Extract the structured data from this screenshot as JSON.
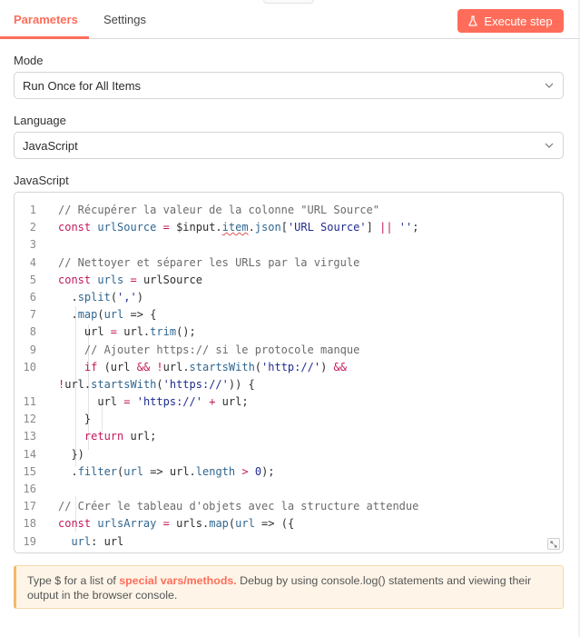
{
  "tabs": [
    {
      "label": "Parameters",
      "active": true
    },
    {
      "label": "Settings",
      "active": false
    }
  ],
  "execute_button": {
    "label": "Execute step",
    "icon": "flask-icon"
  },
  "mode": {
    "label": "Mode",
    "value": "Run Once for All Items"
  },
  "language": {
    "label": "Language",
    "value": "JavaScript"
  },
  "editor": {
    "label": "JavaScript",
    "line_numbers": [
      "1",
      "2",
      "3",
      "4",
      "5",
      "6",
      "7",
      "8",
      "9",
      "10",
      "11",
      "12",
      "13",
      "14",
      "15",
      "16",
      "17",
      "18",
      "19"
    ]
  },
  "notice": {
    "prefix": "Type $ for a list of ",
    "link": "special vars/methods.",
    "suffix": " Debug by using console.log() statements and viewing their output in the browser console."
  },
  "colors": {
    "accent": "#ff6d5a",
    "notice_bg": "#fef5e8",
    "notice_border": "#f4b96b"
  }
}
